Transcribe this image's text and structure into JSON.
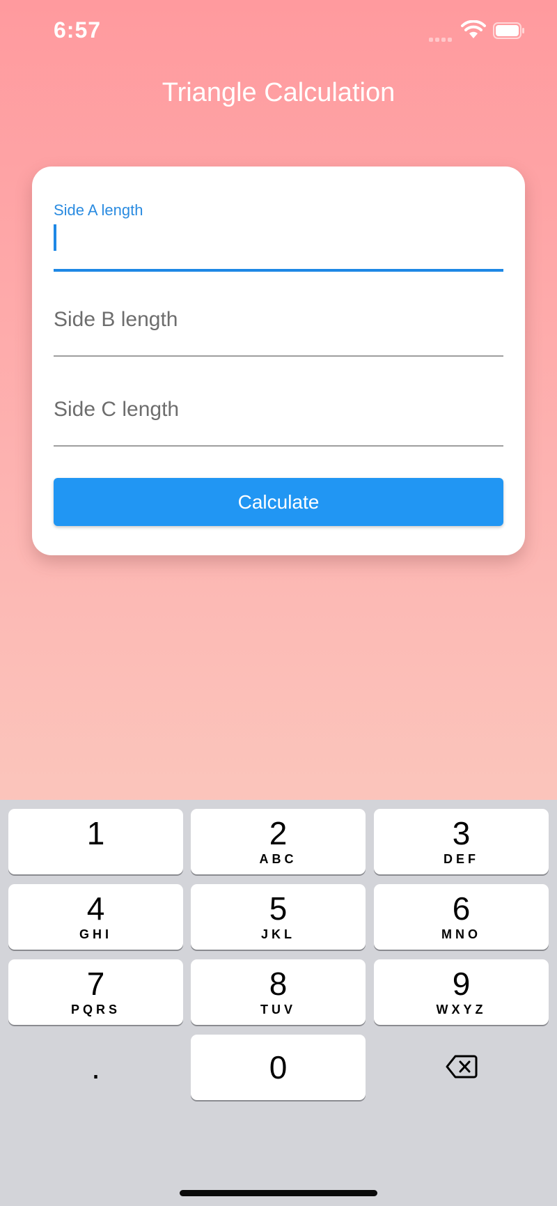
{
  "status_bar": {
    "time": "6:57",
    "icons": [
      "signal-icon",
      "wifi-icon",
      "battery-icon"
    ]
  },
  "app": {
    "title": "Triangle Calculation"
  },
  "form": {
    "side_a": {
      "label": "Side A length",
      "value": "",
      "focused": true
    },
    "side_b": {
      "placeholder": "Side B length",
      "value": ""
    },
    "side_c": {
      "placeholder": "Side C length",
      "value": ""
    },
    "calculate_label": "Calculate"
  },
  "keyboard": {
    "keys": [
      {
        "digit": "1",
        "letters": ""
      },
      {
        "digit": "2",
        "letters": "ABC"
      },
      {
        "digit": "3",
        "letters": "DEF"
      },
      {
        "digit": "4",
        "letters": "GHI"
      },
      {
        "digit": "5",
        "letters": "JKL"
      },
      {
        "digit": "6",
        "letters": "MNO"
      },
      {
        "digit": "7",
        "letters": "PQRS"
      },
      {
        "digit": "8",
        "letters": "TUV"
      },
      {
        "digit": "9",
        "letters": "WXYZ"
      },
      {
        "digit": "0",
        "letters": ""
      }
    ],
    "decimal": ".",
    "backspace_icon": "backspace-icon"
  },
  "colors": {
    "accent": "#2196f3",
    "gradient_top": "#ff9a9e",
    "gradient_bottom": "#fad0c4",
    "keyboard_bg": "#d3d4d9"
  }
}
